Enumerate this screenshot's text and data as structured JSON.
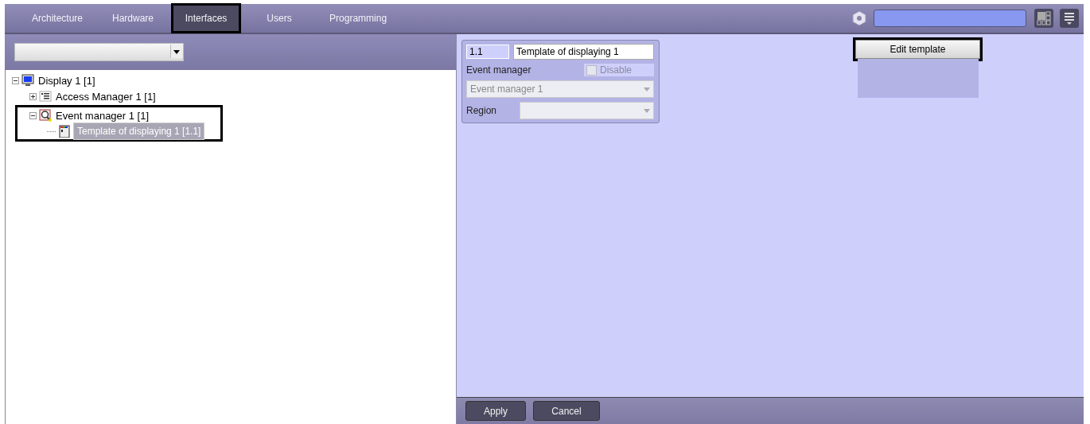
{
  "tabs": [
    {
      "label": "Architecture",
      "selected": false,
      "highlighted": false
    },
    {
      "label": "Hardware",
      "selected": false,
      "highlighted": false
    },
    {
      "label": "Interfaces",
      "selected": true,
      "highlighted": true
    },
    {
      "label": "Users",
      "selected": false,
      "highlighted": false
    },
    {
      "label": "Programming",
      "selected": false,
      "highlighted": false
    }
  ],
  "tree": [
    {
      "label": "Display 1 [1]",
      "kind": "display",
      "expanded": true,
      "selected": false,
      "highlighted": false,
      "children": [
        {
          "label": "Access Manager 1 [1]",
          "kind": "list",
          "expanded": false,
          "selected": false,
          "highlighted": false
        },
        {
          "label": "Event manager 1 [1]",
          "kind": "search",
          "expanded": true,
          "selected": false,
          "highlighted": true,
          "children": [
            {
              "label": "Template of displaying 1 [1.1]",
              "kind": "template",
              "selected": true,
              "highlighted": false
            }
          ]
        }
      ]
    }
  ],
  "properties": {
    "id": "1.1",
    "name": "Template of displaying 1",
    "event_manager_label": "Event manager",
    "disable": {
      "label": "Disable",
      "checked": false,
      "disabled": true
    },
    "event_manager_value": "Event manager 1",
    "region_label": "Region"
  },
  "edit_button": {
    "label": "Edit template",
    "highlighted": true
  },
  "buttons": [
    {
      "label": "Apply"
    },
    {
      "label": "Cancel"
    }
  ]
}
